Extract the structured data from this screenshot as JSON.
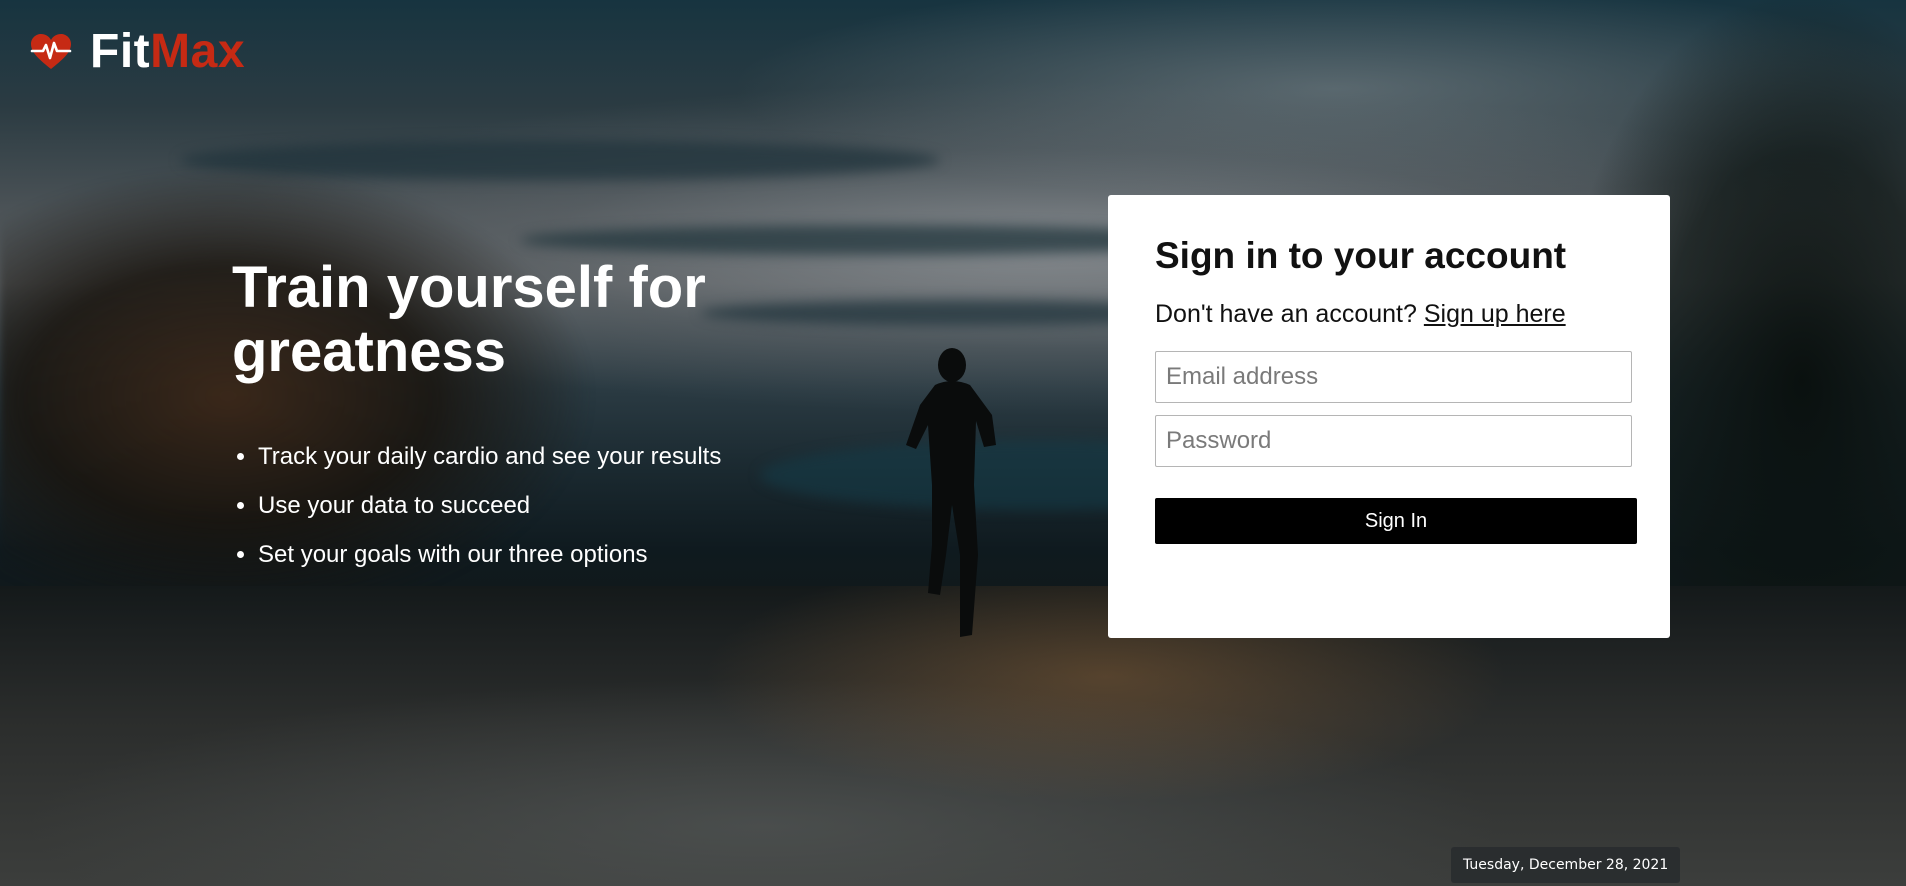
{
  "brand": {
    "name_part1": "Fit",
    "name_part2": "Max",
    "icon": "heartbeat-icon",
    "accent_color": "#c62a14"
  },
  "hero": {
    "title": "Train yourself for greatness",
    "bullets": [
      "Track your daily cardio and see your results",
      "Use your data to succeed",
      "Set your goals with our three options"
    ]
  },
  "signin": {
    "heading": "Sign in to your account",
    "signup_prompt": "Don't have an account?",
    "signup_link": "Sign up here",
    "email_placeholder": "Email address",
    "email_value": "",
    "password_placeholder": "Password",
    "password_value": "",
    "button_label": "Sign In"
  },
  "status": {
    "date": "Tuesday, December 28, 2021"
  },
  "background": {
    "description_icon": "runner-at-dusk-photo"
  }
}
